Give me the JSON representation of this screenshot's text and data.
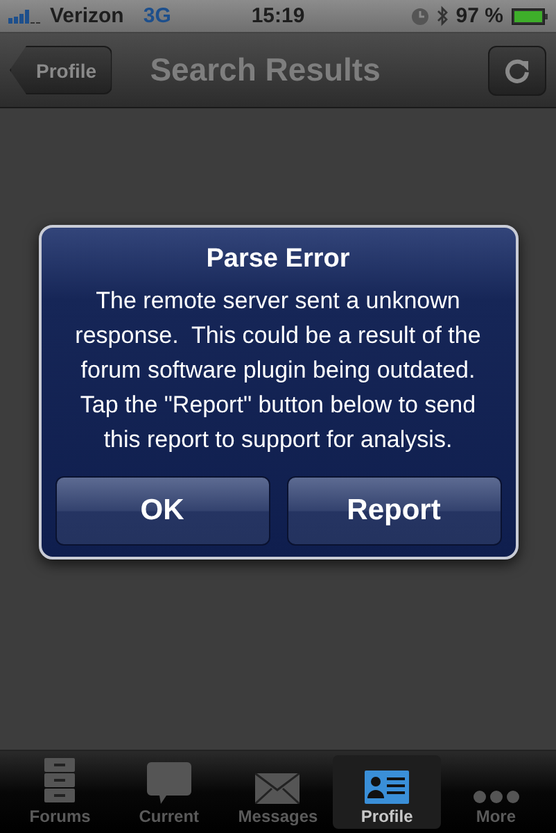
{
  "status_bar": {
    "carrier": "Verizon",
    "network": "3G",
    "time": "15:19",
    "battery": "97 %"
  },
  "nav_bar": {
    "back": "Profile",
    "title": "Search Results"
  },
  "alert": {
    "title": "Parse Error",
    "message": "The remote server sent a unknown response.  This could be a result of the forum software plugin being outdated.  Tap the \"Report\" button below to send this report to support for analysis.",
    "buttons": [
      "OK",
      "Report"
    ]
  },
  "tab_bar": [
    {
      "label": "Forums",
      "kind": "cabinet",
      "selected": false
    },
    {
      "label": "Current",
      "kind": "bubble",
      "selected": false
    },
    {
      "label": "Messages",
      "kind": "envelope",
      "selected": false
    },
    {
      "label": "Profile",
      "kind": "card",
      "selected": true
    },
    {
      "label": "More",
      "kind": "dots",
      "selected": false
    }
  ]
}
